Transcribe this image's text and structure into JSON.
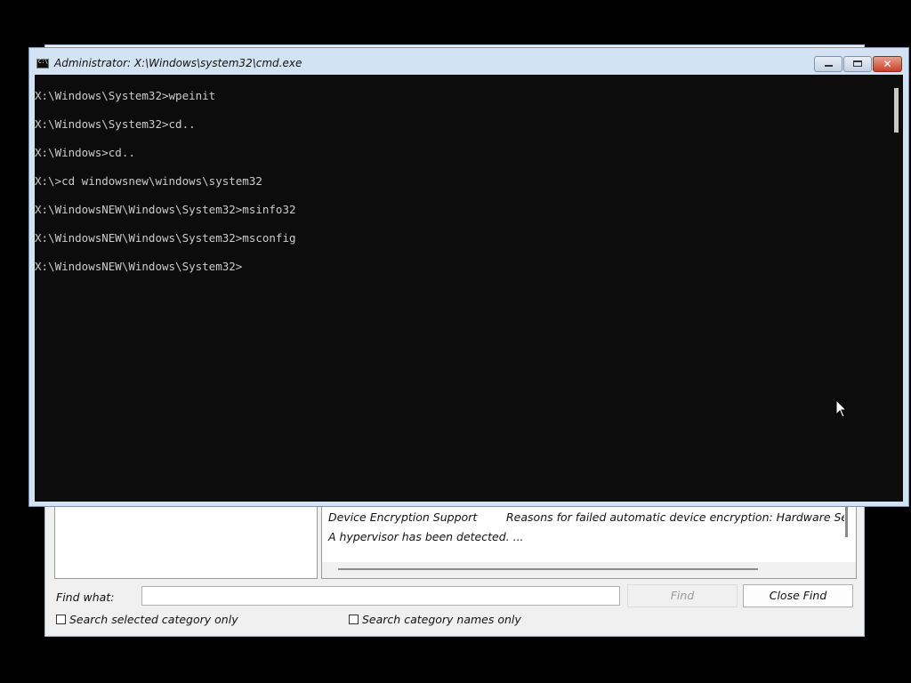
{
  "msinfo": {
    "details": [
      {
        "item": "Device Encryption Support",
        "value": "Reasons for failed automatic device encryption: Hardware Security T"
      },
      {
        "item": "A hypervisor has been detected. ...",
        "value": ""
      }
    ],
    "find_label": "Find what:",
    "find_value": "",
    "find_button": "Find",
    "close_find_button": "Close Find",
    "checkbox_selected_category": "Search selected category only",
    "checkbox_category_names": "Search category names only"
  },
  "cmd": {
    "title": "Administrator: X:\\Windows\\system32\\cmd.exe",
    "close_glyph": "✕",
    "lines": [
      "X:\\Windows\\System32>wpeinit",
      "X:\\Windows\\System32>cd..",
      "X:\\Windows>cd..",
      "X:\\>cd windowsnew\\windows\\system32",
      "X:\\WindowsNEW\\Windows\\System32>msinfo32",
      "X:\\WindowsNEW\\Windows\\System32>msconfig",
      "X:\\WindowsNEW\\Windows\\System32>"
    ]
  }
}
